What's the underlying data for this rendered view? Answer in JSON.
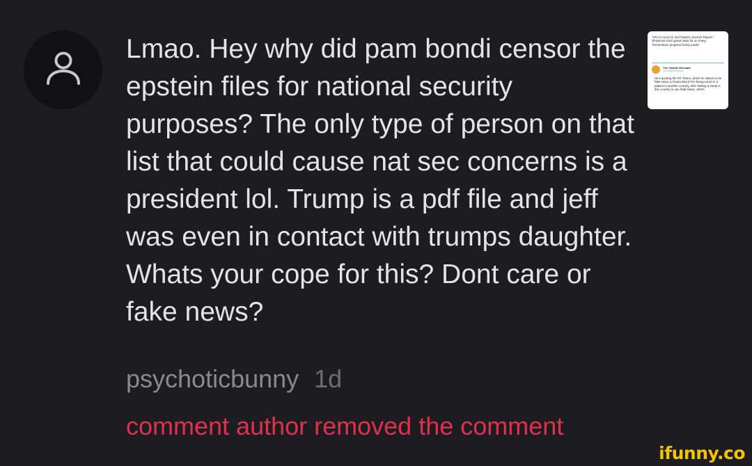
{
  "comment": {
    "text": "Lmao. Hey why did pam bondi censor the epstein files for national security purposes? The only type of person on that list that could cause nat sec concerns is a president lol. Trump is a pdf file and jeff was even in contact with trumps daughter. Whats your cope for this? Dont care or fake news?",
    "username": "psychoticbunny",
    "age": "1d",
    "status": "comment author removed the comment",
    "avatar_icon": "user-icon"
  },
  "attachment": {
    "quote_text": "\"HIV Is Cured in 2nd Patient, Doctors Report.\" @nytimes Such great news for so many. Tremendous progress being made!",
    "author_name": "The Volatile Mermaid",
    "author_handle": "@VolatileMermaid",
    "reply_text": "He's quoting the NY Times, which he claims to be fake news, to boast about HIV being cured in a patient in another country, after halting a study in this country to use fetal tissue, which"
  },
  "watermark": "ifunny.co",
  "colors": {
    "background": "#1d1d21",
    "text": "#e4e4e6",
    "username": "#8a8a8e",
    "removed": "#e0304e",
    "watermark": "#f2c400"
  }
}
